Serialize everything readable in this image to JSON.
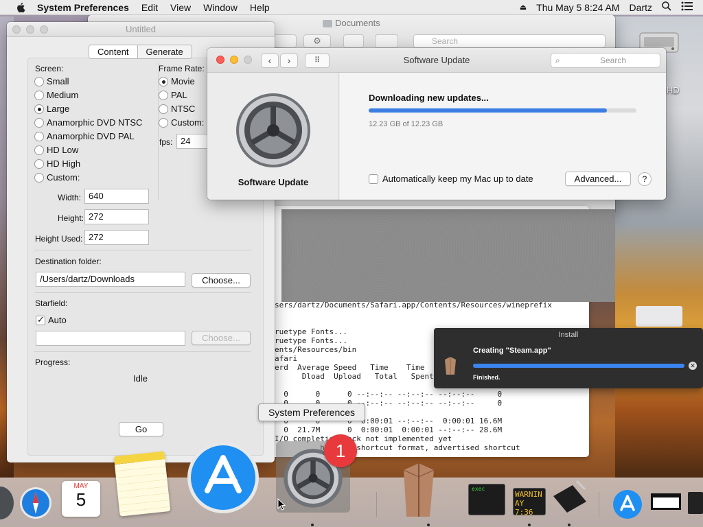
{
  "menubar": {
    "app_name": "System Preferences",
    "menus": [
      "Edit",
      "View",
      "Window",
      "Help"
    ],
    "clock": "Thu May 5  8:24 AM",
    "user": "Dartz"
  },
  "finder": {
    "title": "Documents",
    "search_placeholder": "Search"
  },
  "desktop": {
    "drive_label": "h HD"
  },
  "untitled": {
    "title": "Untitled",
    "tabs": [
      "Content",
      "Generate"
    ],
    "screen_label": "Screen:",
    "screen_options": [
      "Small",
      "Medium",
      "Large",
      "Anamorphic DVD NTSC",
      "Anamorphic DVD PAL",
      "HD Low",
      "HD High",
      "Custom:"
    ],
    "screen_selected": "Large",
    "frame_rate_label": "Frame Rate:",
    "frame_rate_options": [
      "Movie",
      "PAL",
      "NTSC",
      "Custom:"
    ],
    "frame_rate_selected": "Movie",
    "fps_label": "fps:",
    "fps_value": "24",
    "width_label": "Width:",
    "width_value": "640",
    "height_label": "Height:",
    "height_value": "272",
    "height_used_label": "Height Used:",
    "height_used_value": "272",
    "destination_label": "Destination folder:",
    "destination_value": "/Users/dartz/Downloads",
    "choose_label": "Choose...",
    "starfield_label": "Starfield:",
    "auto_label": "Auto",
    "auto_checked": true,
    "starfield_value": "",
    "choose2_label": "Choose...",
    "progress_label": "Progress:",
    "progress_status": "Idle",
    "go_label": "Go"
  },
  "software_update": {
    "title": "Software Update",
    "search_placeholder": "Search",
    "pane_label": "Software Update",
    "status": "Downloading new updates...",
    "progress_fraction": 0.89,
    "size_text": "12.23 GB of 12.23 GB",
    "auto_update_label": "Automatically keep my Mac up to date",
    "auto_update_checked": false,
    "advanced_label": "Advanced...",
    "help_label": "?"
  },
  "terminal_lines": [
    "sers/dartz/Documents/Safari.app/Contents/Resources/wineprefix",
    "",
    "",
    "ruetype Fonts...",
    "ruetype Fonts...",
    "ents/Resources/bin",
    "afari",
    "erd  Average Speed   Time    Time     Time  Current",
    "      Dload  Upload   Total   Spent    Left  Speed",
    "",
    "  0      0      0 --:--:-- --:--:-- --:--:--     0",
    "  0      0      0 --:--:-- --:--:-- --:--:--     0",
    "",
    "  0      0      0  0:00:01 --:--:--  0:00:01 16.6M",
    "  0  21.7M      0  0:00:01  0:00:01 --:--:-- 28.6M",
    "I/O completion lock not implemented yet",
    "          handled shortcut format, advertised shortcut"
  ],
  "install": {
    "header": "Install",
    "message": "Creating \"Steam.app\"",
    "progress_fraction": 1.0,
    "status": "Finished."
  },
  "tooltip": "System Preferences",
  "dock": {
    "calendar_month": "MAY",
    "calendar_day": "5",
    "badge_count": "1",
    "console_label": "exec",
    "warning_label": "WARNIN",
    "warning_time": "AY 7:36"
  }
}
